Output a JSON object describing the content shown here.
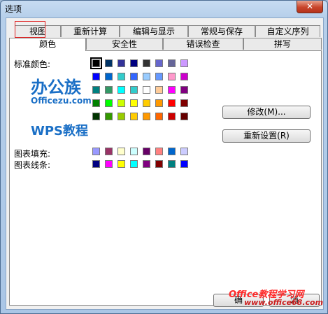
{
  "window": {
    "title": "选项",
    "close_glyph": "✕"
  },
  "tabs_row1": [
    "视图",
    "重新计算",
    "编辑与显示",
    "常规与保存",
    "自定义序列"
  ],
  "tabs_row2": [
    "颜色",
    "安全性",
    "错误检查",
    "拼写"
  ],
  "labels": {
    "standard": "标准颜色:",
    "fill": "图表填充:",
    "line": "图表线条:"
  },
  "buttons": {
    "modify": "修改(M)...",
    "reset": "重新设置(R)",
    "ok": "确",
    "cancel": "消"
  },
  "standard_colors": [
    [
      "#000000",
      "#003366",
      "#333399",
      "#000080",
      "#333333",
      "#6666cc",
      "#666699",
      "#cc99ff"
    ],
    [
      "#0000ff",
      "#0066cc",
      "#33cccc",
      "#3366ff",
      "#99ccff",
      "#6699ff",
      "#ff99cc",
      "#cc00cc"
    ],
    [
      "#008080",
      "#339966",
      "#00ffff",
      "#33cccc",
      "#ffffff",
      "#ffcc99",
      "#ff00ff",
      "#800080"
    ],
    [
      "#008000",
      "#00ff00",
      "#ccff00",
      "#ffff00",
      "#ffcc00",
      "#ff9900",
      "#ff0000",
      "#800000"
    ],
    [
      "#003300",
      "#339900",
      "#99cc00",
      "#ffcc00",
      "#ff9900",
      "#ff6600",
      "#cc0000",
      "#660000"
    ]
  ],
  "fill_colors": [
    "#9999ff",
    "#993366",
    "#ffffcc",
    "#ccffff",
    "#660066",
    "#ff8080",
    "#0066cc",
    "#ccccff"
  ],
  "line_colors": [
    "#000080",
    "#ff00ff",
    "#ffff00",
    "#00ffff",
    "#800080",
    "#800000",
    "#008080",
    "#0000ff"
  ],
  "watermark": {
    "brand": "办公族",
    "brand_url": "Officezu.com",
    "wps": "WPS教程",
    "site": "Office教程学习网",
    "site_url": "www.office68.com"
  }
}
